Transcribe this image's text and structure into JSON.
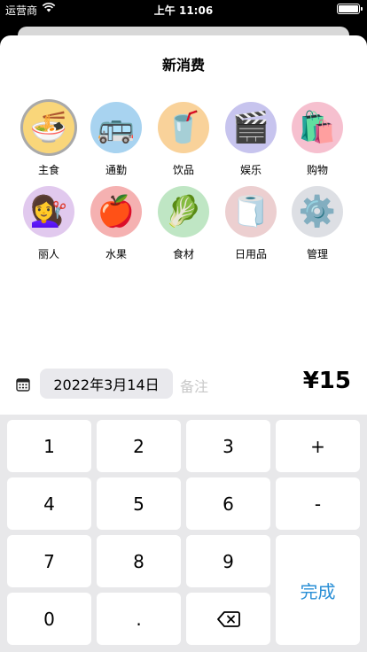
{
  "status": {
    "carrier": "运营商",
    "time": "上午 11:06"
  },
  "sheet": {
    "title": "新消费"
  },
  "categories": [
    {
      "label": "主食",
      "emoji": "🍜",
      "color": "#f9d67a",
      "icon": "noodle-bowl-icon"
    },
    {
      "label": "通勤",
      "emoji": "🚌",
      "color": "#a8d3f0",
      "icon": "bus-icon"
    },
    {
      "label": "饮品",
      "emoji": "🥤",
      "color": "#f9d29a",
      "icon": "cup-with-straw-icon"
    },
    {
      "label": "娱乐",
      "emoji": "🎬",
      "color": "#c7c4ee",
      "icon": "clapper-board-icon"
    },
    {
      "label": "购物",
      "emoji": "🛍️",
      "color": "#f6c0cf",
      "icon": "shopping-bags-icon"
    },
    {
      "label": "丽人",
      "emoji": "💇‍♀️",
      "color": "#e1c9ee",
      "icon": "haircut-icon"
    },
    {
      "label": "水果",
      "emoji": "🍎",
      "color": "#f5b1b1",
      "icon": "apple-icon"
    },
    {
      "label": "食材",
      "emoji": "🥬",
      "color": "#bfe6c4",
      "icon": "leafy-green-icon"
    },
    {
      "label": "日用品",
      "emoji": "🧻",
      "color": "#eccfd0",
      "icon": "toilet-paper-icon"
    },
    {
      "label": "管理",
      "emoji": "⚙️",
      "color": "#dddfe4",
      "icon": "gear-icon"
    }
  ],
  "entry": {
    "date": "2022年3月14日",
    "note_placeholder": "备注",
    "amount": "¥15"
  },
  "keypad": {
    "k1": "1",
    "k2": "2",
    "k3": "3",
    "plus": "+",
    "k4": "4",
    "k5": "5",
    "k6": "6",
    "minus": "-",
    "k7": "7",
    "k8": "8",
    "k9": "9",
    "done": "完成",
    "k0": "0",
    "dot": "."
  },
  "colors": {
    "accent": "#2a8fd6",
    "keypad_bg": "#e8e8ea",
    "selected_ring": "#a9a9a9"
  }
}
